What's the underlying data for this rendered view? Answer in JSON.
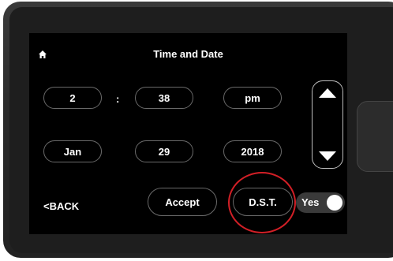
{
  "header": {
    "title": "Time and Date",
    "home_icon": "home-icon"
  },
  "time": {
    "hour": "2",
    "separator": ":",
    "minute": "38",
    "meridiem": "pm"
  },
  "date": {
    "month": "Jan",
    "day": "29",
    "year": "2018"
  },
  "controls": {
    "back_label": "<BACK",
    "accept_label": "Accept",
    "dst_label": "D.S.T.",
    "dst_toggle_label": "Yes",
    "dst_enabled": true
  },
  "scroll": {
    "up_icon": "up-arrow-icon",
    "down_icon": "down-arrow-icon"
  },
  "colors": {
    "screen_background": "#000000",
    "highlight_circle": "#d21f26",
    "pill_border": "#6a6a6a"
  }
}
